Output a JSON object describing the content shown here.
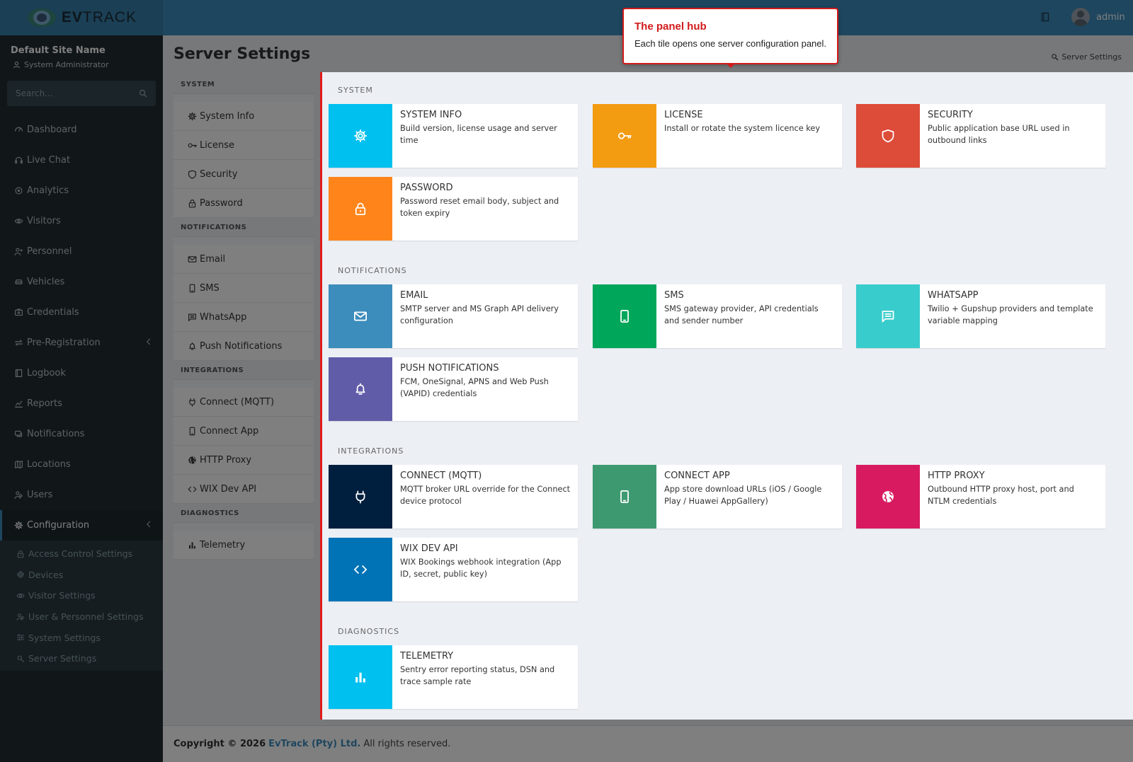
{
  "brand": {
    "logo_bold": "EV",
    "logo_rest": "TRACK"
  },
  "header": {
    "user": "admin"
  },
  "user_panel": {
    "site_name": "Default Site Name",
    "role": "System Administrator"
  },
  "search": {
    "placeholder": "Search..."
  },
  "nav": [
    {
      "label": "Dashboard",
      "icon": "dashboard-icon"
    },
    {
      "label": "Live Chat",
      "icon": "headset-icon"
    },
    {
      "label": "Analytics",
      "icon": "target-icon"
    },
    {
      "label": "Visitors",
      "icon": "eye-icon"
    },
    {
      "label": "Personnel",
      "icon": "person-icon"
    },
    {
      "label": "Vehicles",
      "icon": "car-icon"
    },
    {
      "label": "Credentials",
      "icon": "badge-icon"
    },
    {
      "label": "Pre-Registration",
      "icon": "swap-icon"
    },
    {
      "label": "Logbook",
      "icon": "book-icon"
    },
    {
      "label": "Reports",
      "icon": "chart-icon"
    },
    {
      "label": "Notifications",
      "icon": "chat-icon"
    },
    {
      "label": "Locations",
      "icon": "map-icon"
    },
    {
      "label": "Users",
      "icon": "users-icon"
    },
    {
      "label": "Configuration",
      "icon": "gear-icon"
    }
  ],
  "config_submenu": [
    {
      "label": "Access Control Settings",
      "icon": "lock-icon"
    },
    {
      "label": "Devices",
      "icon": "device-icon"
    },
    {
      "label": "Visitor Settings",
      "icon": "eye-icon"
    },
    {
      "label": "User & Personnel Settings",
      "icon": "users-icon"
    },
    {
      "label": "System Settings",
      "icon": "sliders-icon"
    },
    {
      "label": "Server Settings",
      "icon": "server-gear-icon"
    }
  ],
  "page": {
    "title": "Server Settings",
    "breadcrumb": "Server Settings"
  },
  "subnav": [
    {
      "group": "SYSTEM",
      "items": [
        "System Info",
        "License",
        "Security",
        "Password"
      ]
    },
    {
      "group": "NOTIFICATIONS",
      "items": [
        "Email",
        "SMS",
        "WhatsApp",
        "Push Notifications"
      ]
    },
    {
      "group": "INTEGRATIONS",
      "items": [
        "Connect (MQTT)",
        "Connect App",
        "HTTP Proxy",
        "WIX Dev API"
      ]
    },
    {
      "group": "DIAGNOSTICS",
      "items": [
        "Telemetry"
      ]
    }
  ],
  "sections": [
    {
      "label": "SYSTEM",
      "tiles": [
        {
          "title": "SYSTEM INFO",
          "desc": "Build version, license usage and server time",
          "color": "#00c0ef",
          "icon": "gear-icon"
        },
        {
          "title": "LICENSE",
          "desc": "Install or rotate the system licence key",
          "color": "#f39c12",
          "icon": "key-icon"
        },
        {
          "title": "SECURITY",
          "desc": "Public application base URL used in outbound links",
          "color": "#dd4b39",
          "icon": "shield-icon"
        },
        {
          "title": "PASSWORD",
          "desc": "Password reset email body, subject and token expiry",
          "color": "#ff851b",
          "icon": "lock-icon"
        }
      ]
    },
    {
      "label": "NOTIFICATIONS",
      "tiles": [
        {
          "title": "EMAIL",
          "desc": "SMTP server and MS Graph API delivery configuration",
          "color": "#3c8dbc",
          "icon": "envelope-icon"
        },
        {
          "title": "SMS",
          "desc": "SMS gateway provider, API credentials and sender number",
          "color": "#00a65a",
          "icon": "phone-icon"
        },
        {
          "title": "WHATSAPP",
          "desc": "Twilio + Gupshup providers and template variable mapping",
          "color": "#39cccc",
          "icon": "message-icon"
        },
        {
          "title": "PUSH NOTIFICATIONS",
          "desc": "FCM, OneSignal, APNS and Web Push (VAPID) credentials",
          "color": "#605ca8",
          "icon": "bell-icon"
        }
      ]
    },
    {
      "label": "INTEGRATIONS",
      "tiles": [
        {
          "title": "CONNECT (MQTT)",
          "desc": "MQTT broker URL override for the Connect device protocol",
          "color": "#001f3f",
          "icon": "plug-icon"
        },
        {
          "title": "CONNECT APP",
          "desc": "App store download URLs (iOS / Google Play / Huawei AppGallery)",
          "color": "#3d9970",
          "icon": "phone-icon"
        },
        {
          "title": "HTTP PROXY",
          "desc": "Outbound HTTP proxy host, port and NTLM credentials",
          "color": "#d81b60",
          "icon": "globe-icon"
        },
        {
          "title": "WIX DEV API",
          "desc": "WIX Bookings webhook integration (App ID, secret, public key)",
          "color": "#0073b7",
          "icon": "code-icon"
        }
      ]
    },
    {
      "label": "DIAGNOSTICS",
      "tiles": [
        {
          "title": "TELEMETRY",
          "desc": "Sentry error reporting status, DSN and trace sample rate",
          "color": "#00c0ef",
          "icon": "bar-chart-icon"
        }
      ]
    }
  ],
  "callout": {
    "title": "The panel hub",
    "text": "Each tile opens one server configuration panel."
  },
  "footer": {
    "prefix": "Copyright © 2026",
    "company": "EvTrack (Pty) Ltd.",
    "suffix": "All rights reserved."
  }
}
